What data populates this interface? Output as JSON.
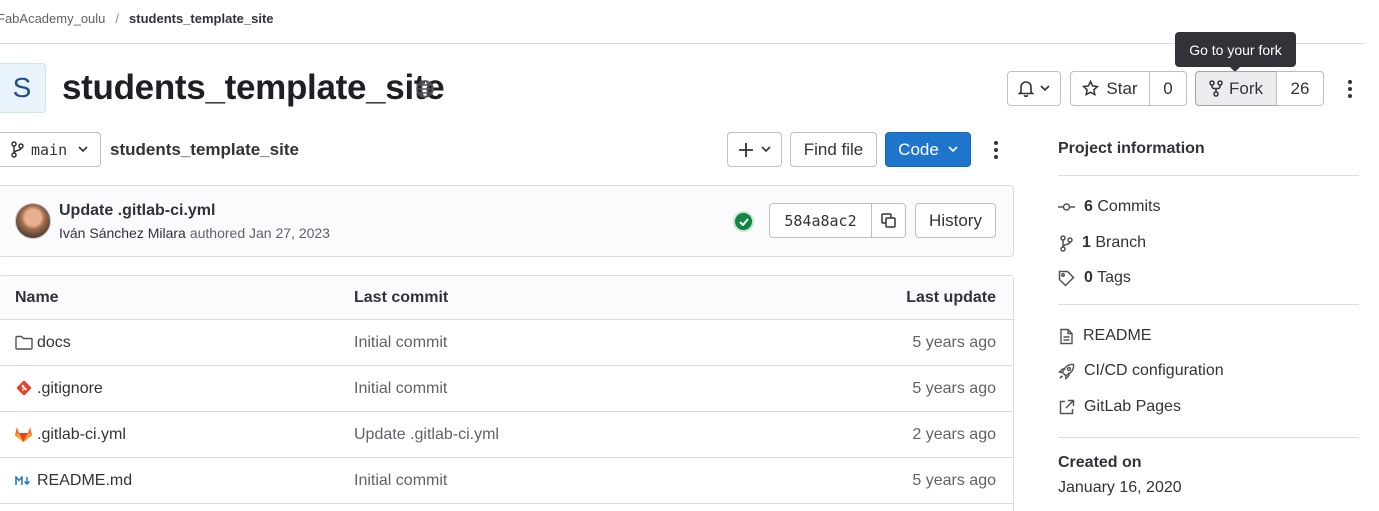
{
  "breadcrumb": {
    "group": "FabAcademy_oulu",
    "separator": "/",
    "project": "students_template_site"
  },
  "tooltip": "Go to your fork",
  "project": {
    "avatar_letter": "S",
    "title": "students_template_site"
  },
  "header_actions": {
    "star_label": "Star",
    "star_count": "0",
    "fork_label": "Fork",
    "fork_count": "26"
  },
  "repo_toolbar": {
    "branch": "main",
    "path": "students_template_site",
    "find_file": "Find file",
    "code": "Code"
  },
  "last_commit": {
    "message": "Update .gitlab-ci.yml",
    "author": "Iván Sánchez Milara",
    "authored_text": "authored Jan 27, 2023",
    "sha": "584a8ac2",
    "history": "History"
  },
  "table": {
    "headers": {
      "name": "Name",
      "last_commit": "Last commit",
      "last_update": "Last update"
    },
    "rows": [
      {
        "icon": "folder-icon",
        "name": "docs",
        "commit": "Initial commit",
        "updated": "5 years ago"
      },
      {
        "icon": "git-icon",
        "name": ".gitignore",
        "commit": "Initial commit",
        "updated": "5 years ago"
      },
      {
        "icon": "gitlab-icon",
        "name": ".gitlab-ci.yml",
        "commit": "Update .gitlab-ci.yml",
        "updated": "2 years ago"
      },
      {
        "icon": "markdown-icon",
        "name": "README.md",
        "commit": "Initial commit",
        "updated": "5 years ago"
      }
    ]
  },
  "sidebar": {
    "title": "Project information",
    "stats": [
      {
        "icon": "commit-icon",
        "count": "6",
        "label": "Commits"
      },
      {
        "icon": "branch-icon",
        "count": "1",
        "label": "Branch"
      },
      {
        "icon": "tag-icon",
        "count": "0",
        "label": "Tags"
      }
    ],
    "links": [
      {
        "icon": "document-icon",
        "label": "README"
      },
      {
        "icon": "rocket-icon",
        "label": "CI/CD configuration"
      },
      {
        "icon": "external-link-icon",
        "label": "GitLab Pages"
      }
    ],
    "created_label": "Created on",
    "created_date": "January 16, 2020"
  },
  "colors": {
    "primary": "#1f75cb",
    "success": "#108548",
    "border": "#dcdcde",
    "text": "#333238"
  }
}
